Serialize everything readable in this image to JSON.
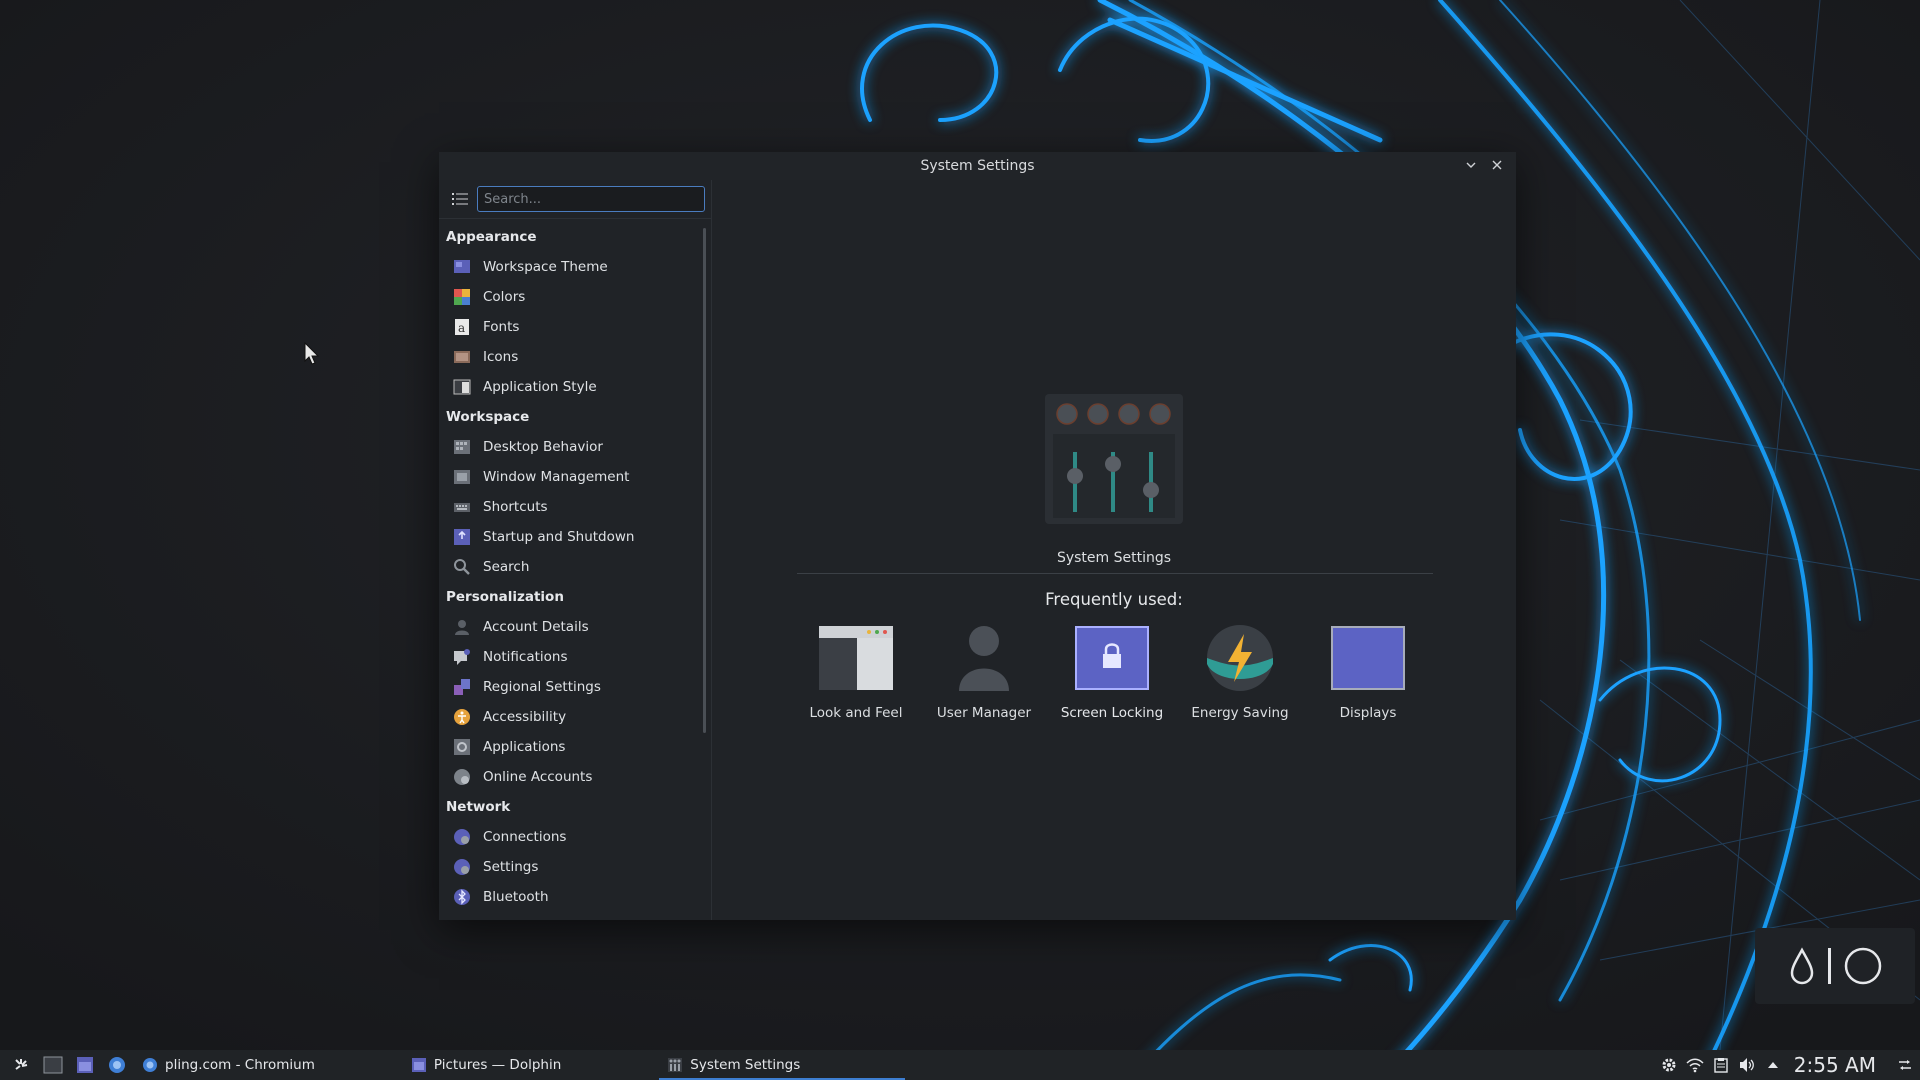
{
  "window": {
    "title": "System Settings"
  },
  "search": {
    "placeholder": "Search..."
  },
  "sidebar": {
    "categories": [
      {
        "label": "Appearance",
        "items": [
          "Workspace Theme",
          "Colors",
          "Fonts",
          "Icons",
          "Application Style"
        ]
      },
      {
        "label": "Workspace",
        "items": [
          "Desktop Behavior",
          "Window Management",
          "Shortcuts",
          "Startup and Shutdown",
          "Search"
        ]
      },
      {
        "label": "Personalization",
        "items": [
          "Account Details",
          "Notifications",
          "Regional Settings",
          "Accessibility",
          "Applications",
          "Online Accounts"
        ]
      },
      {
        "label": "Network",
        "items": [
          "Connections",
          "Settings",
          "Bluetooth"
        ]
      }
    ]
  },
  "main": {
    "hero_label": "System Settings",
    "frequently_used_title": "Frequently used:",
    "frequently_used": [
      "Look and Feel",
      "User Manager",
      "Screen Locking",
      "Energy Saving",
      "Displays"
    ]
  },
  "taskbar": {
    "tasks": [
      "pling.com - Chromium",
      "Pictures — Dolphin",
      "System Settings"
    ],
    "active_task": "System Settings",
    "clock": "2:55 AM"
  },
  "icons": {
    "taskbar_left": [
      "launcher-icon",
      "terminal-icon",
      "file-manager-icon",
      "browser-icon"
    ],
    "tray": [
      "settings-gear-icon",
      "wifi-icon",
      "clipboard-icon",
      "volume-icon",
      "tray-expand-icon",
      "panel-config-icon"
    ]
  },
  "colors": {
    "accent": "#3d7ed1",
    "window_bg": "#202327",
    "panel_bg": "#202326"
  }
}
